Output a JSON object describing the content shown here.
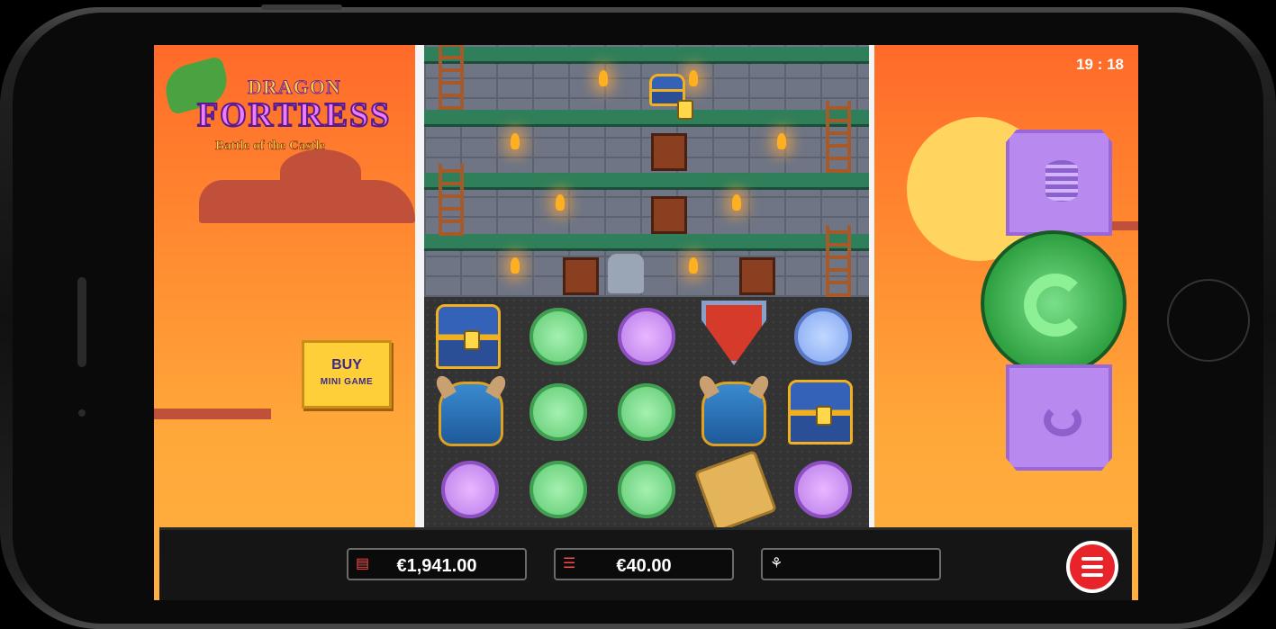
{
  "status_bar": {
    "time": "19 : 18"
  },
  "logo": {
    "line1": "DRAGON",
    "line2": "FORTRESS",
    "line3": "Battle of the Castle"
  },
  "buy_button": {
    "line1": "BUY",
    "line2": "MINI GAME"
  },
  "reels": {
    "rows": [
      [
        "treasure-chest",
        "green-coin",
        "purple-coin",
        "shield",
        "blue-coin"
      ],
      [
        "knight-helmet",
        "green-coin",
        "green-coin",
        "knight-helmet",
        "treasure-chest"
      ],
      [
        "purple-coin",
        "green-coin",
        "green-coin",
        "winged-scroll",
        "purple-coin"
      ]
    ]
  },
  "controls": {
    "bet_button": "coins-icon",
    "spin_button": "spin-arrow-icon",
    "autoplay_button": "autoplay-icon"
  },
  "footer": {
    "balance": "€1,941.00",
    "bet": "€40.00",
    "win": "",
    "balance_icon": "wallet-icon",
    "bet_icon": "coins-icon",
    "win_icon": "trophy-icon"
  }
}
